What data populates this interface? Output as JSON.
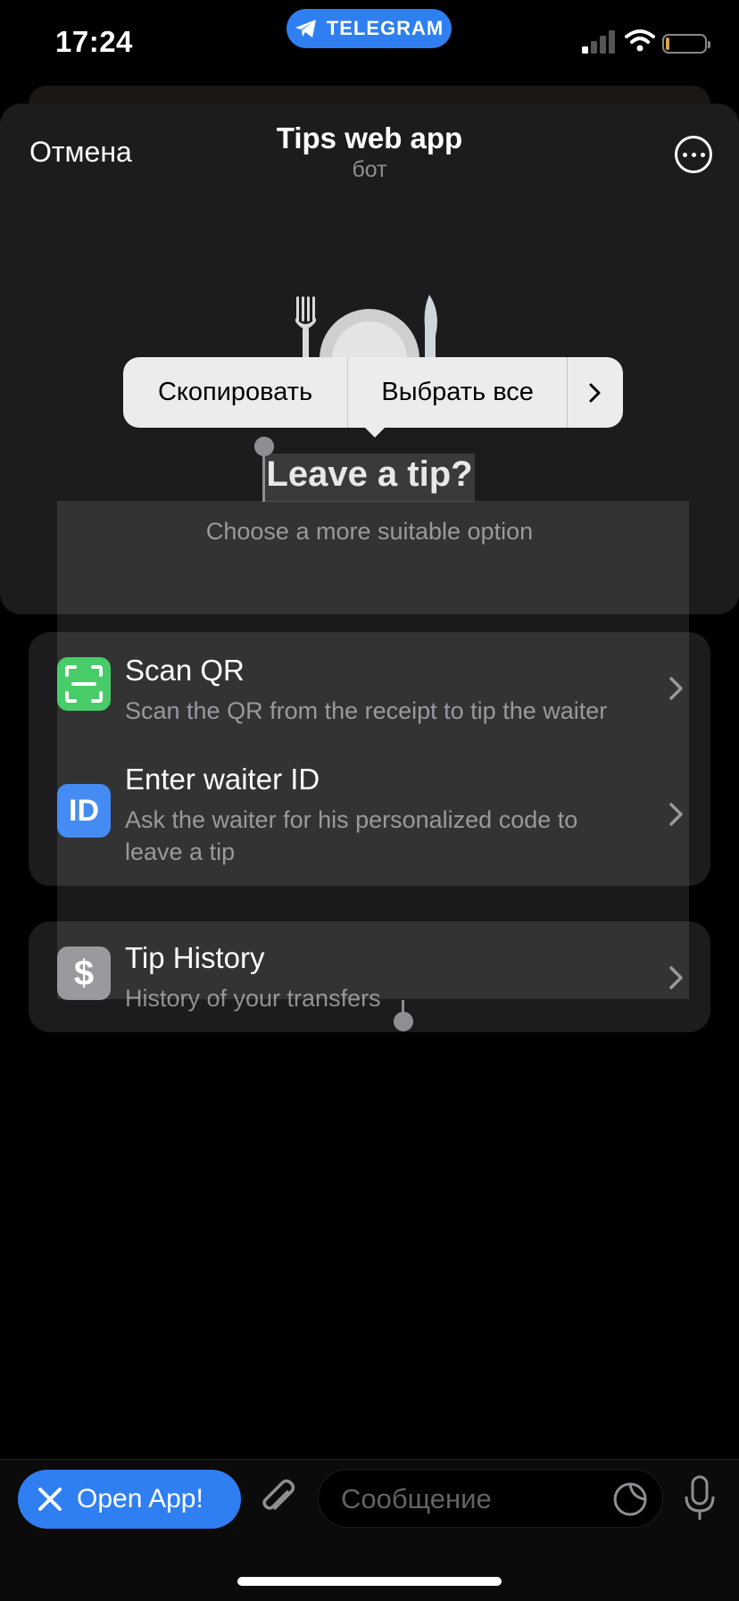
{
  "status_bar": {
    "time": "17:24",
    "telegram_pill": "TELEGRAM"
  },
  "header": {
    "cancel_label": "Отмена",
    "title": "Tips web app",
    "subtitle": "бот",
    "more_icon": "ellipsis-circle-icon"
  },
  "context_menu": {
    "copy_label": "Скопировать",
    "select_all_label": "Выбрать все",
    "next_icon": "chevron-right-icon"
  },
  "hero": {
    "illustration_icon": "fork-plate-knife-icon",
    "headline": "Leave a tip?",
    "description": "Choose a more suitable option"
  },
  "options": [
    {
      "title": "Scan QR",
      "subtitle": "Scan the QR from the receipt to tip the waiter",
      "icon": "qr-scan-icon",
      "icon_color": "#34c759"
    },
    {
      "title": "Enter waiter ID",
      "subtitle_line1": "Ask the waiter for his personalized code to",
      "subtitle_line2": "leave a tip",
      "icon": "id-icon",
      "icon_text": "ID",
      "icon_color": "#2f7ff2"
    }
  ],
  "history": {
    "title": "Tip History",
    "subtitle": "History of your transfers",
    "icon": "dollar-icon",
    "icon_text": "$",
    "icon_color": "#8e8e93"
  },
  "bottom_bar": {
    "open_app_label": "Open App!",
    "message_placeholder": "Сообщение"
  },
  "colors": {
    "accent": "#2f7ff2",
    "background": "#000000",
    "card": "#1c1c1e",
    "secondary_text": "#8e8e93"
  }
}
